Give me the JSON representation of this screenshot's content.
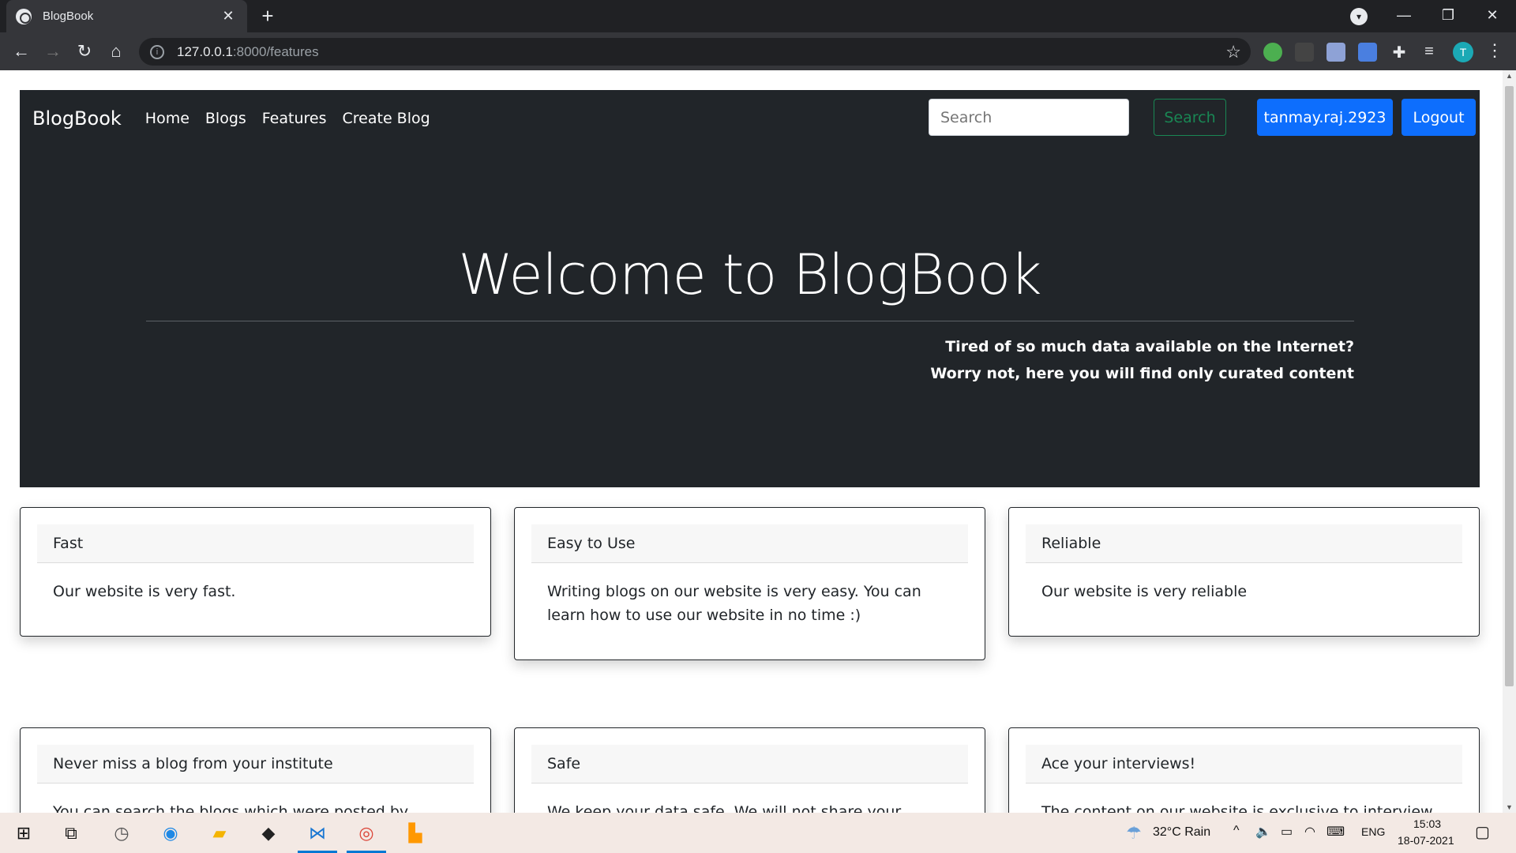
{
  "browser": {
    "tab_title": "BlogBook",
    "tab_close": "✕",
    "new_tab": "+",
    "url_host": "127.0.0.1",
    "url_path": ":8000/features",
    "profile_initial": "T",
    "window_controls": {
      "minimize": "—",
      "restore": "❐",
      "close": "✕"
    }
  },
  "navbar": {
    "brand": "BlogBook",
    "links": [
      "Home",
      "Blogs",
      "Features",
      "Create Blog"
    ],
    "search_placeholder": "Search",
    "search_button": "Search",
    "username": "tanmay.raj.2923",
    "logout": "Logout"
  },
  "hero": {
    "title": "Welcome to BlogBook",
    "tagline_1": "Tired of so much data available on the Internet?",
    "tagline_2": "Worry not, here you will find only curated content"
  },
  "features": [
    {
      "title": "Fast",
      "body": "Our website is very fast."
    },
    {
      "title": "Easy to Use",
      "body": "Writing blogs on our website is very easy. You can learn how to use our website in no time :)"
    },
    {
      "title": "Reliable",
      "body": "Our website is very reliable"
    },
    {
      "title": "Never miss a blog from your institute",
      "body": "You can search the blogs which were posted by students"
    },
    {
      "title": "Safe",
      "body": "We keep your data safe. We will not share your emails"
    },
    {
      "title": "Ace your interviews!",
      "body": "The content on our website is exclusive to interview"
    }
  ],
  "taskbar": {
    "weather": "32°C  Rain",
    "language": "ENG",
    "time": "15:03",
    "date": "18-07-2021"
  }
}
